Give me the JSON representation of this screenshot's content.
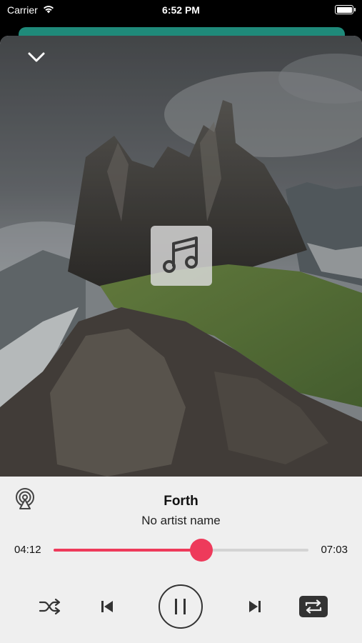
{
  "status_bar": {
    "carrier": "Carrier",
    "time": "6:52 PM",
    "icons": [
      "wifi-icon",
      "battery-icon"
    ]
  },
  "player": {
    "collapse_icon": "chevron-down-icon",
    "artwork_placeholder_icon": "music-note-icon",
    "airplay_icon": "airplay-icon",
    "track_title": "Forth",
    "artist": "No artist name",
    "elapsed": "04:12",
    "duration": "07:03",
    "progress": 0.58,
    "controls": [
      "shuffle-icon",
      "previous-icon",
      "pause-icon",
      "next-icon",
      "repeat-icon"
    ],
    "colors": {
      "accent": "#ee3a5b",
      "panel": "#efefef",
      "card_behind": "#1f8a7a"
    }
  }
}
